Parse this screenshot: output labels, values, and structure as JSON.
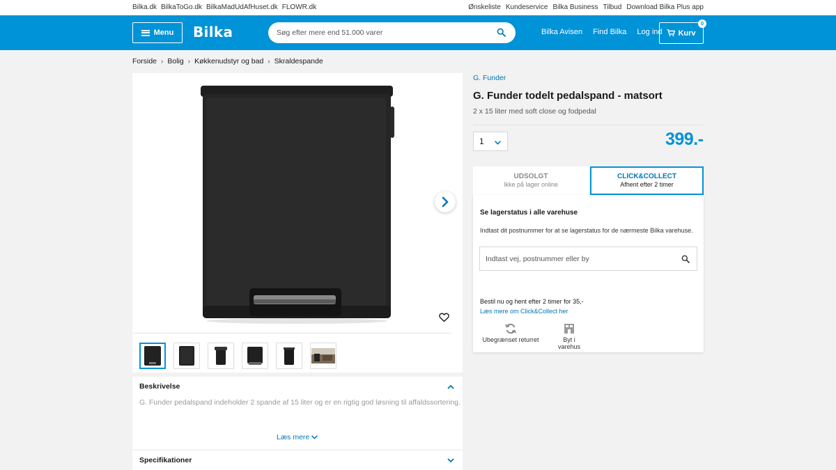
{
  "topbar": {
    "left_links": [
      "Bilka.dk",
      "BilkaToGo.dk",
      "BilkaMadUdAfHuset.dk",
      "FLOWR.dk"
    ],
    "right_links": [
      "Ønskeliste",
      "Kundeservice",
      "Bilka Business",
      "Tilbud",
      "Download Bilka Plus app"
    ]
  },
  "header": {
    "menu_label": "Menu",
    "logo_text": "Bilka",
    "search_placeholder": "Søg efter mere end 51.000 varer",
    "nav_links": [
      "Bilka Avisen",
      "Find Bilka",
      "Log ind"
    ],
    "cart_label": "Kurv",
    "cart_count": "0",
    "brand_color": "#0093d7"
  },
  "breadcrumb": [
    "Forside",
    "Bolig",
    "Køkkenudstyr og bad",
    "Skraldespande"
  ],
  "product": {
    "brand": "G. Funder",
    "title": "G. Funder todelt pedalspand - matsort",
    "subtitle": "2 x 15 liter med soft close og fodpedal",
    "quantity": "1",
    "price": "399.-",
    "thumbnail_count": 6,
    "active_thumbnail": 1
  },
  "delivery_tabs": {
    "soldout_title": "UDSOLGT",
    "soldout_sub": "Ikke på lager online",
    "cc_title": "CLICK&COLLECT",
    "cc_sub": "Afhent efter 2 timer"
  },
  "stock": {
    "title": "Se lagerstatus i alle varehuse",
    "text": "Indtast dit postnummer for at se lagerstatus for de nærmeste Bilka varehuse.",
    "input_placeholder": "Indtast vej, postnummer eller by",
    "order_text": "Bestil nu og hent efter 2 timer for 35,-",
    "cc_link": "Læs mere om Click&Collect her",
    "features": [
      "Ubegrænset returret",
      "Byt i varehus"
    ]
  },
  "description": {
    "title": "Beskrivelse",
    "text": "G. Funder pedalspand indeholder 2 spande af 15 liter og er en rigtig god løsning til affaldssortering.",
    "read_more": "Læs mere"
  },
  "specs": {
    "title": "Specifikationer"
  }
}
